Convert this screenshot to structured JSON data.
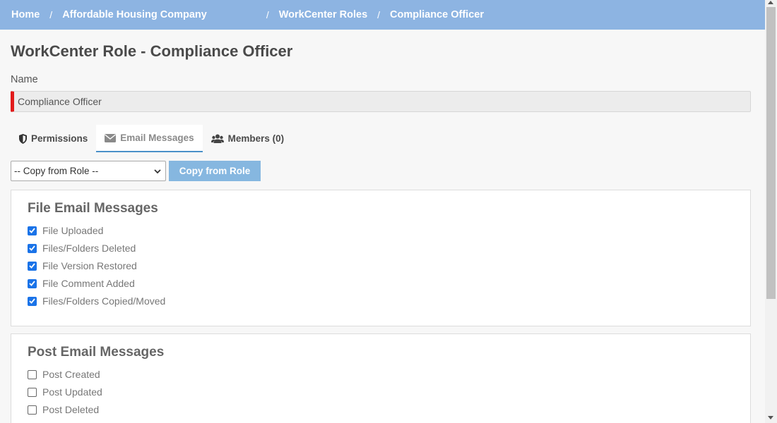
{
  "breadcrumb": {
    "home": "Home",
    "company": "Affordable Housing Company",
    "roles": "WorkCenter Roles",
    "current": "Compliance Officer",
    "separator": "/"
  },
  "page": {
    "title": "WorkCenter Role - Compliance Officer"
  },
  "name_field": {
    "label": "Name",
    "value": "Compliance Officer"
  },
  "tabs": [
    {
      "label": "Permissions",
      "icon": "shield-icon",
      "active": false
    },
    {
      "label": "Email Messages",
      "icon": "envelope-icon",
      "active": true
    },
    {
      "label": "Members (0)",
      "icon": "users-icon",
      "active": false
    }
  ],
  "copy_role": {
    "select_value": "-- Copy from Role --",
    "button_label": "Copy from Role"
  },
  "file_email": {
    "title": "File Email Messages",
    "items": [
      {
        "label": "File Uploaded",
        "checked": true
      },
      {
        "label": "Files/Folders Deleted",
        "checked": true
      },
      {
        "label": "File Version Restored",
        "checked": true
      },
      {
        "label": "File Comment Added",
        "checked": true
      },
      {
        "label": "Files/Folders Copied/Moved",
        "checked": true
      }
    ]
  },
  "post_email": {
    "title": "Post Email Messages",
    "items": [
      {
        "label": "Post Created",
        "checked": false
      },
      {
        "label": "Post Updated",
        "checked": false
      },
      {
        "label": "Post Deleted",
        "checked": false
      }
    ]
  },
  "colors": {
    "header_bar": "#8db4e2",
    "required_marker": "#e21b1b",
    "checkbox_checked": "#1a73e8",
    "button": "#86b7e0"
  }
}
